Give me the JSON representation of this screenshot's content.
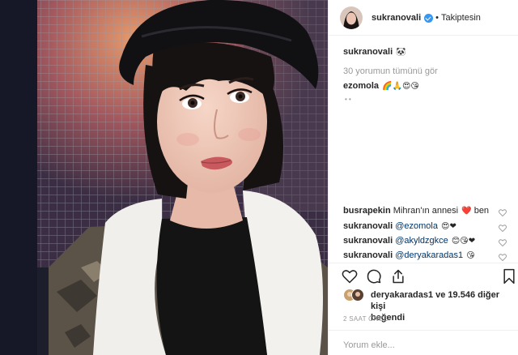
{
  "header": {
    "username": "sukranovali",
    "separator": "•",
    "follow_state": "Takiptesin"
  },
  "caption": {
    "username": "sukranovali",
    "emoji": "🐼"
  },
  "view_all_comments": "30 yorumun tümünü gör",
  "first_comment": {
    "username": "ezomola",
    "emoji": "🌈🙏😍😘"
  },
  "comments": [
    {
      "username": "busrapekin",
      "text": "Mihran'ın annesi",
      "emoji": "❤️",
      "text_after": " ben"
    },
    {
      "username": "sukranovali",
      "mention": "@ezomola",
      "emoji": "😍❤"
    },
    {
      "username": "sukranovali",
      "mention": "@akyldzgkce",
      "emoji": "😊😘❤"
    },
    {
      "username": "sukranovali",
      "mention": "@deryakaradas1",
      "emoji": "😘"
    }
  ],
  "actions": {
    "like_icon": "heart-icon",
    "comment_icon": "comment-icon",
    "share_icon": "share-icon",
    "save_icon": "bookmark-icon"
  },
  "likes": {
    "user": "deryakaradas1",
    "rest": "ve 19.546 diğer kişi",
    "suffix": "beğendi"
  },
  "timestamp": "2 SAAT ÖNCE",
  "add_comment_placeholder": "Yorum ekle...",
  "colors": {
    "verified": "#3897f0",
    "link": "#003569",
    "muted": "#999999",
    "border": "#efefef",
    "heart_red": "#ed4956"
  }
}
